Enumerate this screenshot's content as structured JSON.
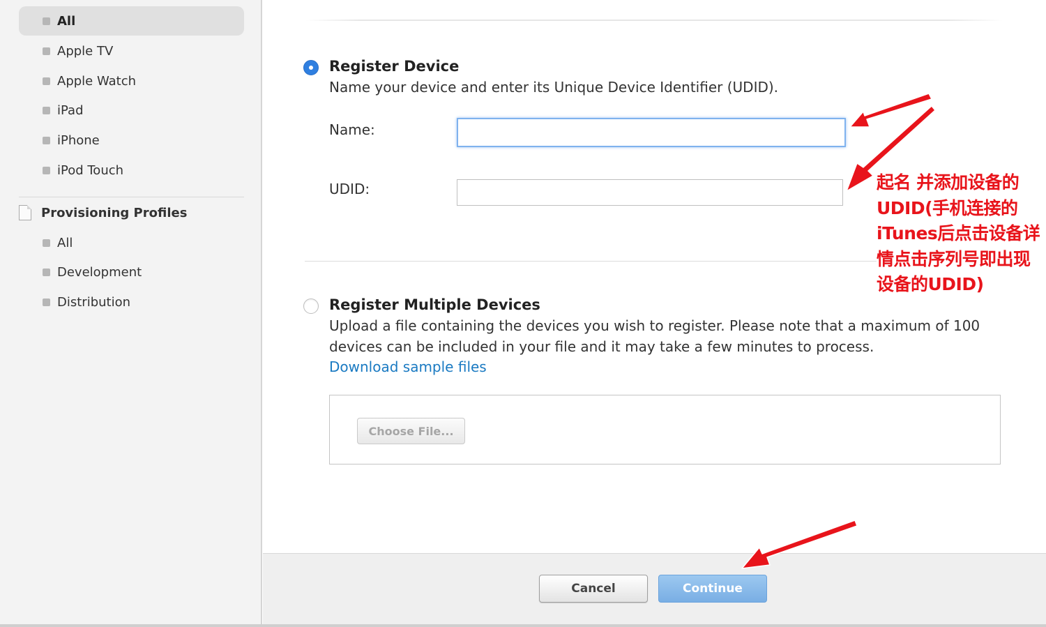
{
  "sidebar": {
    "device_items": [
      {
        "label": "All",
        "selected": true
      },
      {
        "label": "Apple TV",
        "selected": false
      },
      {
        "label": "Apple Watch",
        "selected": false
      },
      {
        "label": "iPad",
        "selected": false
      },
      {
        "label": "iPhone",
        "selected": false
      },
      {
        "label": "iPod Touch",
        "selected": false
      }
    ],
    "profiles_section": {
      "title": "Provisioning Profiles",
      "icon": "document-icon",
      "items": [
        {
          "label": "All"
        },
        {
          "label": "Development"
        },
        {
          "label": "Distribution"
        }
      ]
    }
  },
  "main": {
    "register_device": {
      "title": "Register Device",
      "description": "Name your device and enter its Unique Device Identifier (UDID).",
      "selected": true,
      "name_label": "Name:",
      "name_value": "",
      "udid_label": "UDID:",
      "udid_value": ""
    },
    "register_multiple": {
      "title": "Register Multiple Devices",
      "description": "Upload a file containing the devices you wish to register. Please note that a maximum of 100 devices can be included in your file and it may take a few minutes to process.",
      "selected": false,
      "link": "Download sample files",
      "choose_file": "Choose File..."
    }
  },
  "footer": {
    "cancel": "Cancel",
    "continue": "Continue"
  },
  "annotation": {
    "text": "起名  并添加设备的UDID(手机连接的iTunes后点击设备详情点击序列号即出现设备的UDID)",
    "color": "#e8141b"
  },
  "colors": {
    "accent": "#2f7fe0",
    "link": "#1a7ac2",
    "continue_button": "#86b7e9",
    "arrow": "#e8141b"
  }
}
